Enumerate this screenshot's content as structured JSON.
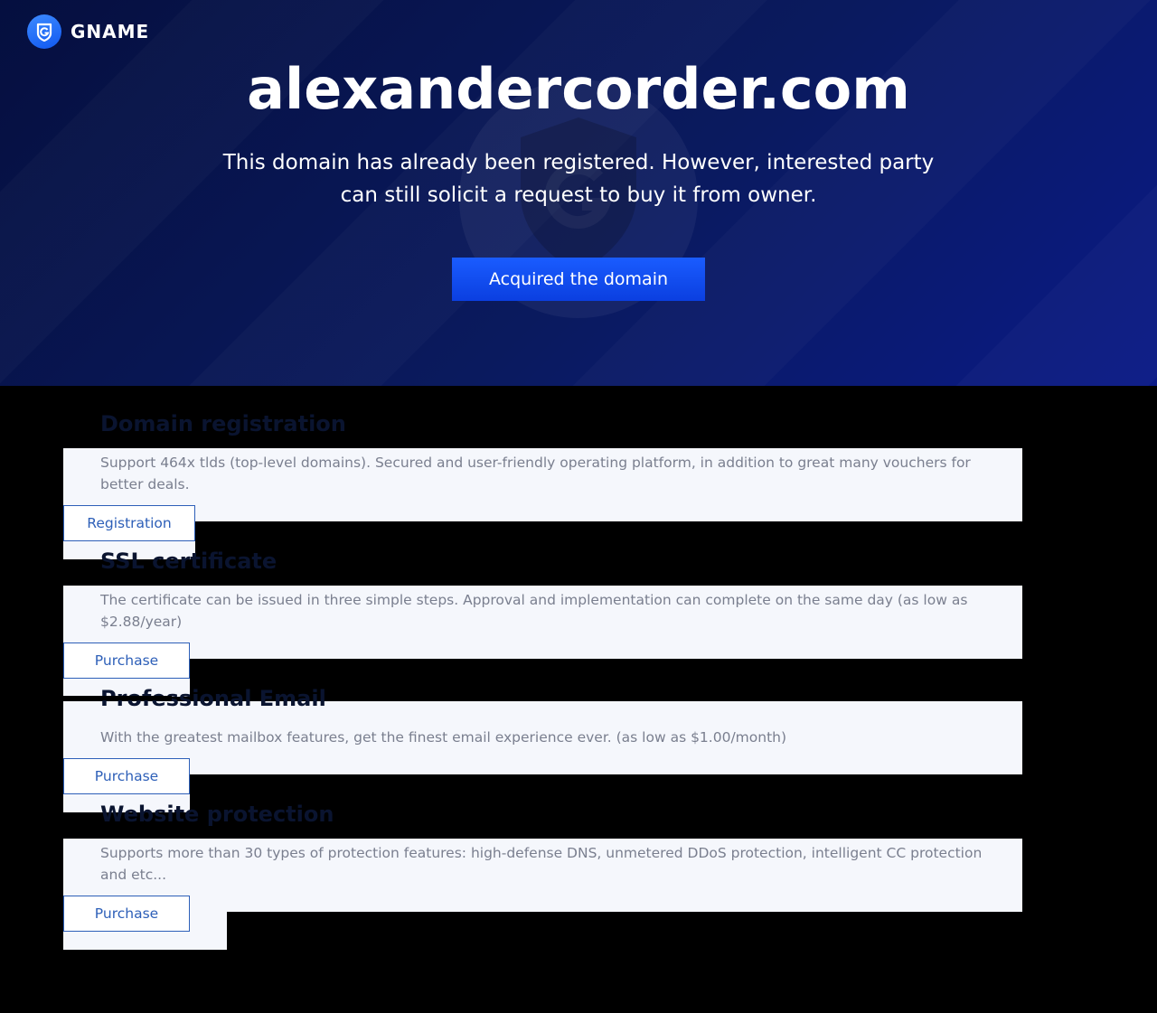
{
  "brand": {
    "name": "GNAME",
    "logo_icon": "gname-g-logo-icon"
  },
  "hero": {
    "domain": "alexandercorder.com",
    "message": "This domain has already been registered. However, interested party can still solicit a request to buy it from owner.",
    "cta_label": "Acquired the domain",
    "watermark_icon": "shield-watermark-icon"
  },
  "services": [
    {
      "title": "Domain registration",
      "description": "Support 464x tlds (top-level domains). Secured and user-friendly operating platform, in addition to great many vouchers for better deals.",
      "button_label": "Registration"
    },
    {
      "title": "SSL certificate",
      "description": "The certificate can be issued in three simple steps. Approval and implementation can complete on the same day (as low as $2.88/year)",
      "button_label": "Purchase"
    },
    {
      "title": "Professional Email",
      "description": "With the greatest mailbox features, get the finest email experience ever. (as low as $1.00/month)",
      "button_label": "Purchase"
    },
    {
      "title": "Website protection",
      "description": "Supports more than 30 types of protection features: high-defense DNS, unmetered DDoS protection, intelligent CC protection and etc...",
      "button_label": "Purchase"
    }
  ],
  "colors": {
    "hero_dark": "#050f3f",
    "hero_light": "#0a1a86",
    "cta_blue": "#1a5cff",
    "card_bg": "#f5f7fc",
    "button_border": "#2d5fb8",
    "desc_text": "#7a7f8f",
    "title_text": "#0a1430"
  }
}
